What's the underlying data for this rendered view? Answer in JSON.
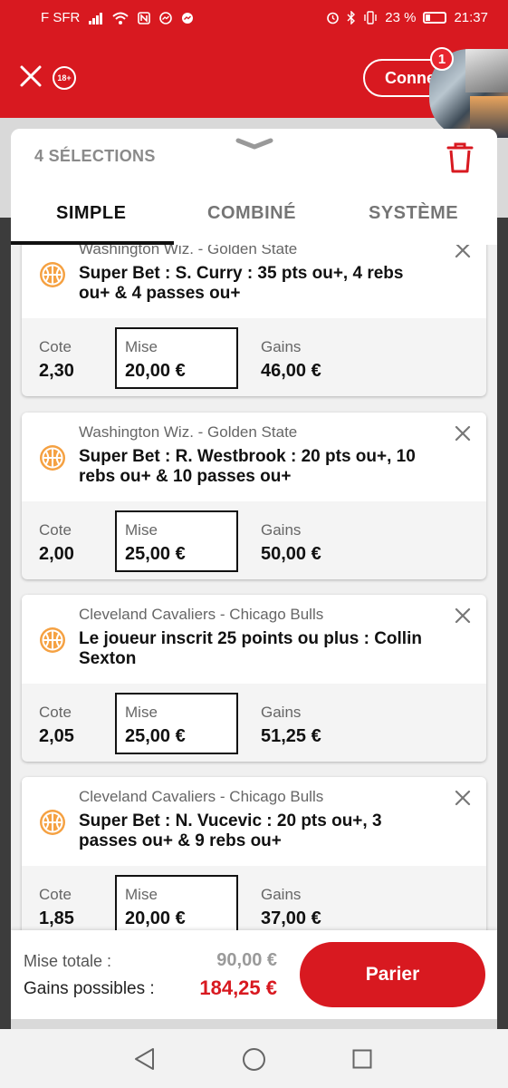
{
  "status_bar": {
    "carrier": "F SFR",
    "battery": "23 %",
    "time": "21:37"
  },
  "header": {
    "age_badge": "18+",
    "connect_label": "Conne",
    "notification_count": "1"
  },
  "slip": {
    "selection_count": "4 SÉLECTIONS",
    "tabs": [
      {
        "label": "SIMPLE",
        "active": true
      },
      {
        "label": "COMBINÉ",
        "active": false
      },
      {
        "label": "SYSTÈME",
        "active": false
      }
    ],
    "odds_label": "Cote",
    "stake_label": "Mise",
    "gains_label": "Gains",
    "bets": [
      {
        "match": "Washington Wiz. - Golden State",
        "selection": "Super Bet : S. Curry : 35 pts ou+, 4 rebs ou+ & 4 passes ou+",
        "odds": "2,30",
        "stake": "20,00 €",
        "gains": "46,00 €"
      },
      {
        "match": "Washington Wiz. - Golden State",
        "selection": "Super Bet : R. Westbrook : 20 pts ou+, 10 rebs ou+ & 10 passes ou+",
        "odds": "2,00",
        "stake": "25,00 €",
        "gains": "50,00 €"
      },
      {
        "match": "Cleveland Cavaliers - Chicago Bulls",
        "selection": "Le joueur inscrit 25 points ou plus : Collin Sexton",
        "odds": "2,05",
        "stake": "25,00 €",
        "gains": "51,25 €"
      },
      {
        "match": "Cleveland Cavaliers - Chicago Bulls",
        "selection": "Super Bet : N. Vucevic : 20 pts ou+, 3 passes ou+ & 9 rebs ou+",
        "odds": "1,85",
        "stake": "20,00 €",
        "gains": "37,00 €"
      }
    ]
  },
  "footer": {
    "total_stake_label": "Mise totale :",
    "total_stake": "90,00 €",
    "potential_gains_label": "Gains possibles :",
    "potential_gains": "184,25 €",
    "bet_button": "Parier"
  },
  "colors": {
    "brand_red": "#d81920",
    "orange_ball": "#f5a142"
  }
}
